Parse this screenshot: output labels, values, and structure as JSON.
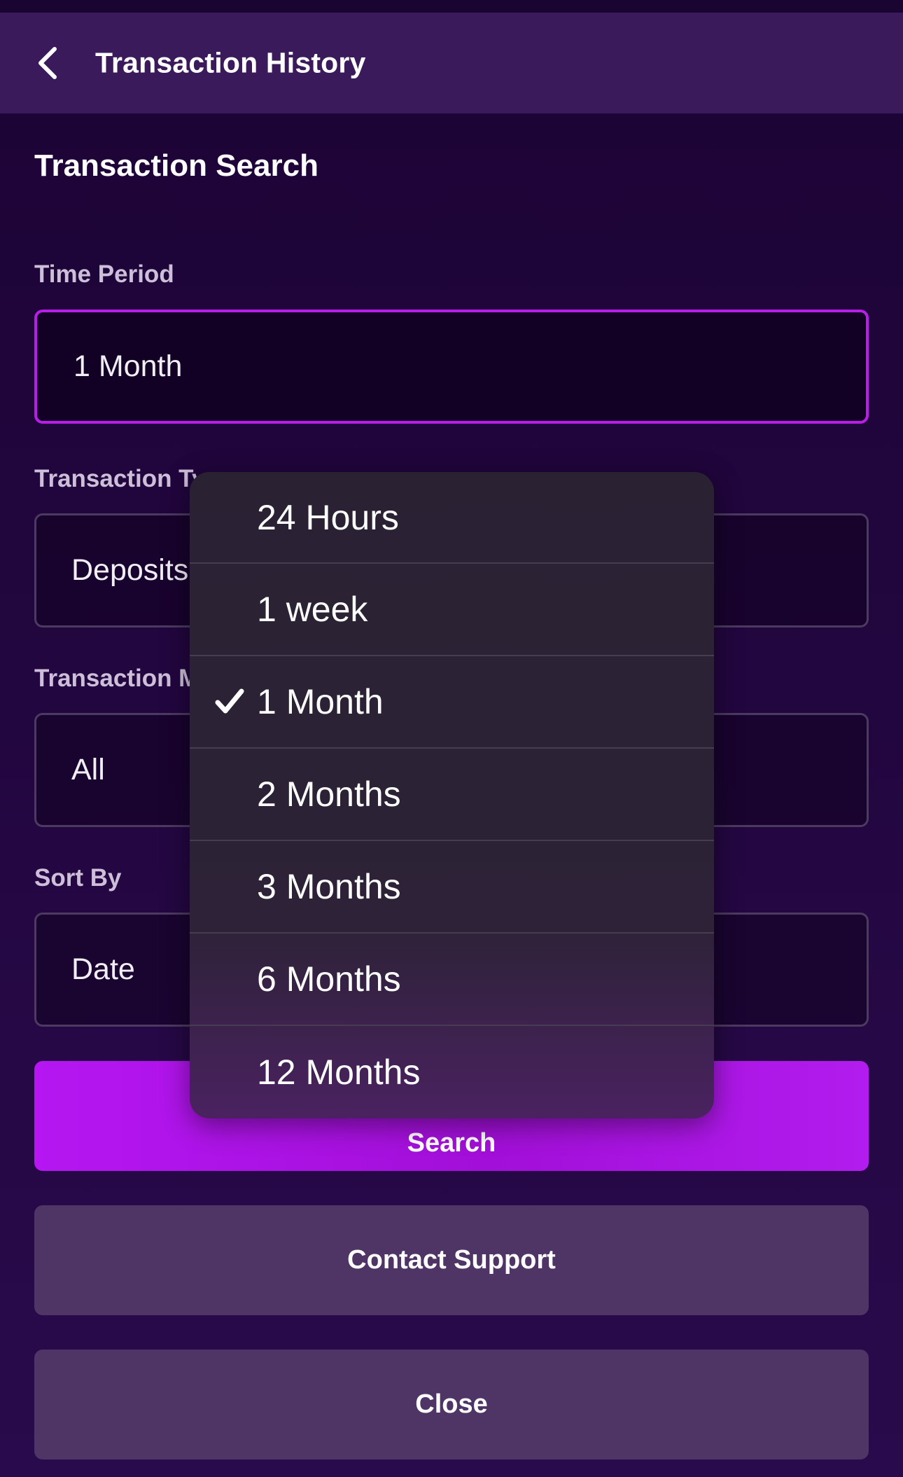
{
  "header": {
    "title": "Transaction History"
  },
  "form": {
    "section_title": "Transaction Search",
    "time_period": {
      "label": "Time Period",
      "value": "1 Month"
    },
    "transaction_type": {
      "label": "Transaction Ty",
      "value": "Deposits"
    },
    "transaction_method": {
      "label": "Transaction M",
      "value": "All"
    },
    "sort_by": {
      "label": "Sort By",
      "value": "Date"
    }
  },
  "buttons": {
    "search": "Search",
    "contact_support": "Contact Support",
    "close": "Close"
  },
  "dropdown": {
    "selected_index": 2,
    "options": [
      "24 Hours",
      "1 week",
      "1 Month",
      "2 Months",
      "3 Months",
      "6 Months",
      "12 Months"
    ]
  },
  "colors": {
    "accent": "#b81ee8",
    "primary_button": "#b516f2",
    "secondary_button": "#4f3566",
    "header": "#3a1a5a",
    "dropdown": "#2a2233"
  },
  "icons": {
    "back": "chevron-left-icon",
    "selected": "checkmark-icon"
  }
}
